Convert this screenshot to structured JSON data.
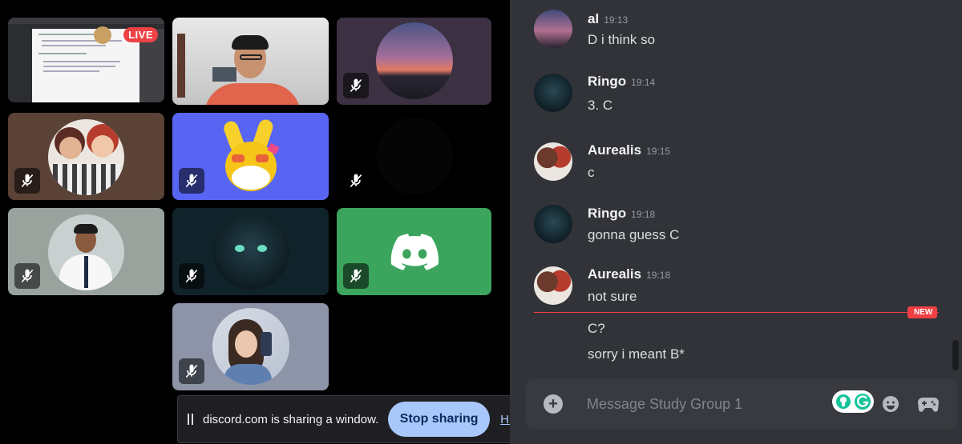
{
  "stage": {
    "live_badge": "LIVE"
  },
  "share_bar": {
    "text": "discord.com is sharing a window.",
    "stop_label": "Stop sharing",
    "hide_label": "Hide"
  },
  "chat": {
    "messages": [
      {
        "author": "al",
        "time": "19:13",
        "lines": [
          "D i think so"
        ]
      },
      {
        "author": "Ringo",
        "time": "19:14",
        "lines": [
          "3. C"
        ]
      },
      {
        "author": "Aurealis",
        "time": "19:15",
        "lines": [
          "c"
        ]
      },
      {
        "author": "Ringo",
        "time": "19:18",
        "lines": [
          "gonna guess C"
        ]
      },
      {
        "author": "Aurealis",
        "time": "19:18",
        "lines": [
          "not sure"
        ]
      }
    ],
    "new_badge": "NEW",
    "after_new": [
      "C?",
      "sorry i meant B*"
    ]
  },
  "composer": {
    "placeholder": "Message Study Group 1"
  },
  "colors": {
    "discord_blurple": "#5865f2",
    "discord_green": "#3ba55d",
    "danger_red": "#f23f43",
    "chat_bg": "#313338"
  },
  "icons": [
    "mic-muted-icon",
    "discord-logo-icon",
    "plus-icon",
    "emoji-icon",
    "gamepad-icon",
    "pause-icon",
    "grammarly-icon"
  ]
}
